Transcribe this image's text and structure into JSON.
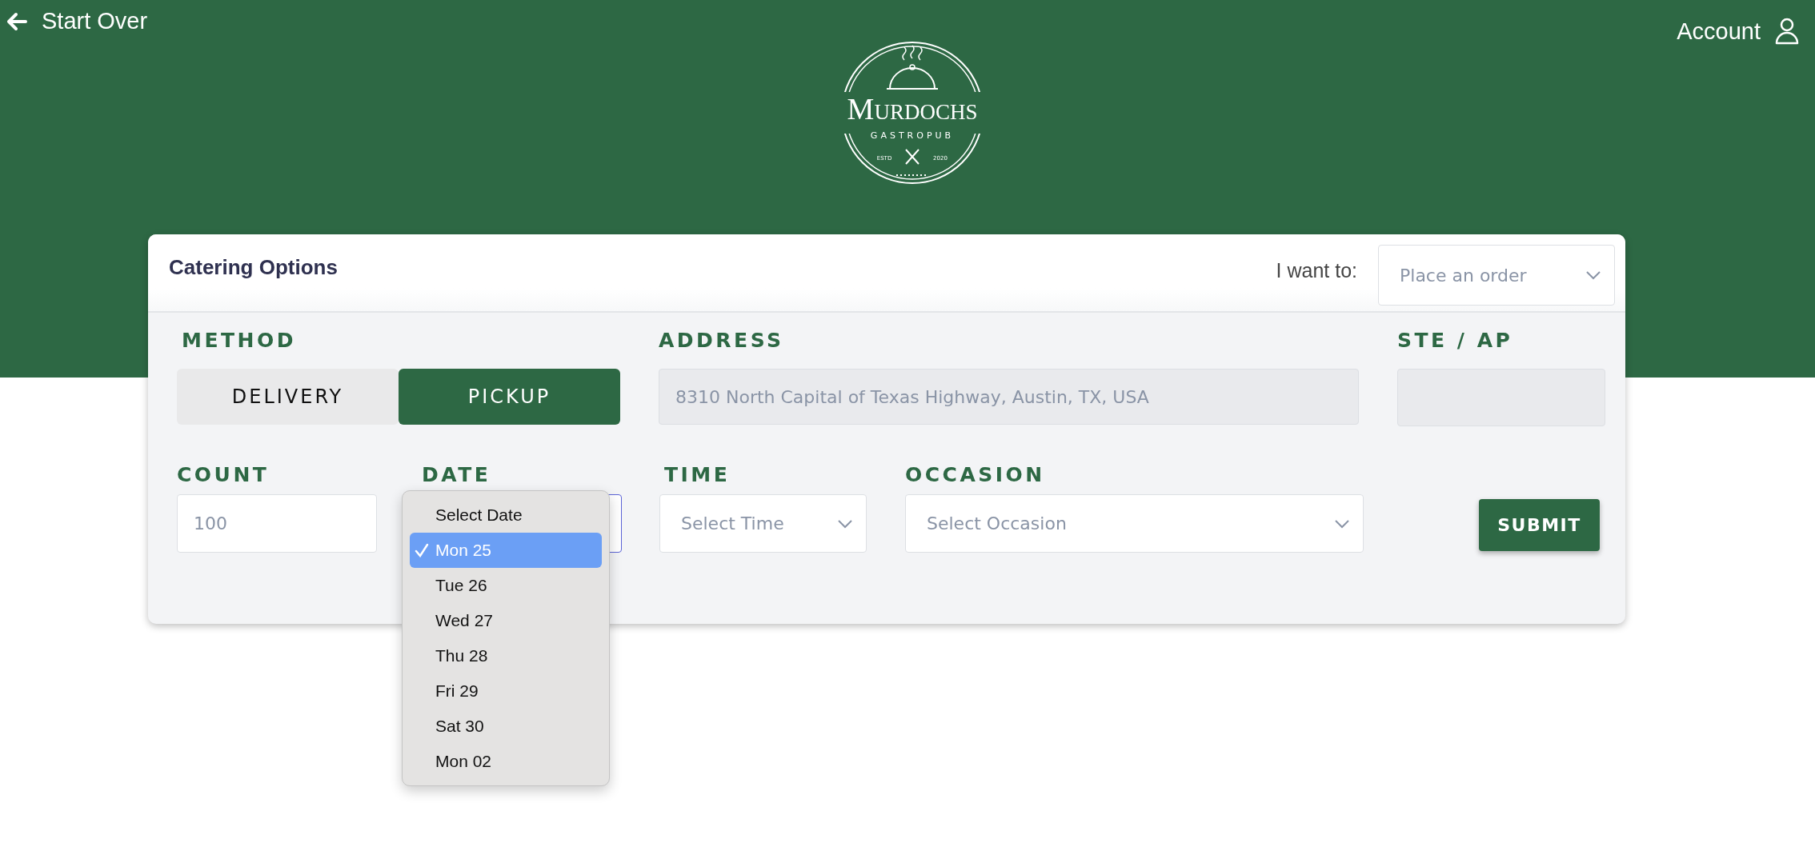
{
  "header": {
    "back_link": "Start Over",
    "account_link": "Account",
    "logo": {
      "name": "Murdochs",
      "tagline": "GASTROPUB",
      "estd_label": "ESTD",
      "year": "2020"
    }
  },
  "card": {
    "title": "Catering Options",
    "intent": {
      "label": "I want to:",
      "placeholder": "Place an order"
    },
    "method": {
      "label": "METHOD",
      "options": [
        {
          "label": "DELIVERY",
          "selected": false
        },
        {
          "label": "PICKUP",
          "selected": true
        }
      ]
    },
    "address": {
      "label": "ADDRESS",
      "value": "8310 North Capital of Texas Highway, Austin, TX, USA",
      "disabled": true
    },
    "suite": {
      "label": "STE / AP",
      "disabled": true
    },
    "count": {
      "label": "COUNT",
      "placeholder": "100"
    },
    "date": {
      "label": "DATE",
      "open": true,
      "options": [
        {
          "label": "Select Date",
          "selected": false
        },
        {
          "label": "Mon 25",
          "selected": true
        },
        {
          "label": "Tue 26",
          "selected": false
        },
        {
          "label": "Wed 27",
          "selected": false
        },
        {
          "label": "Thu 28",
          "selected": false
        },
        {
          "label": "Fri 29",
          "selected": false
        },
        {
          "label": "Sat 30",
          "selected": false
        },
        {
          "label": "Mon 02",
          "selected": false
        }
      ]
    },
    "time": {
      "label": "TIME",
      "placeholder": "Select Time"
    },
    "occasion": {
      "label": "OCCASION",
      "placeholder": "Select Occasion"
    },
    "submit": "SUBMIT"
  }
}
